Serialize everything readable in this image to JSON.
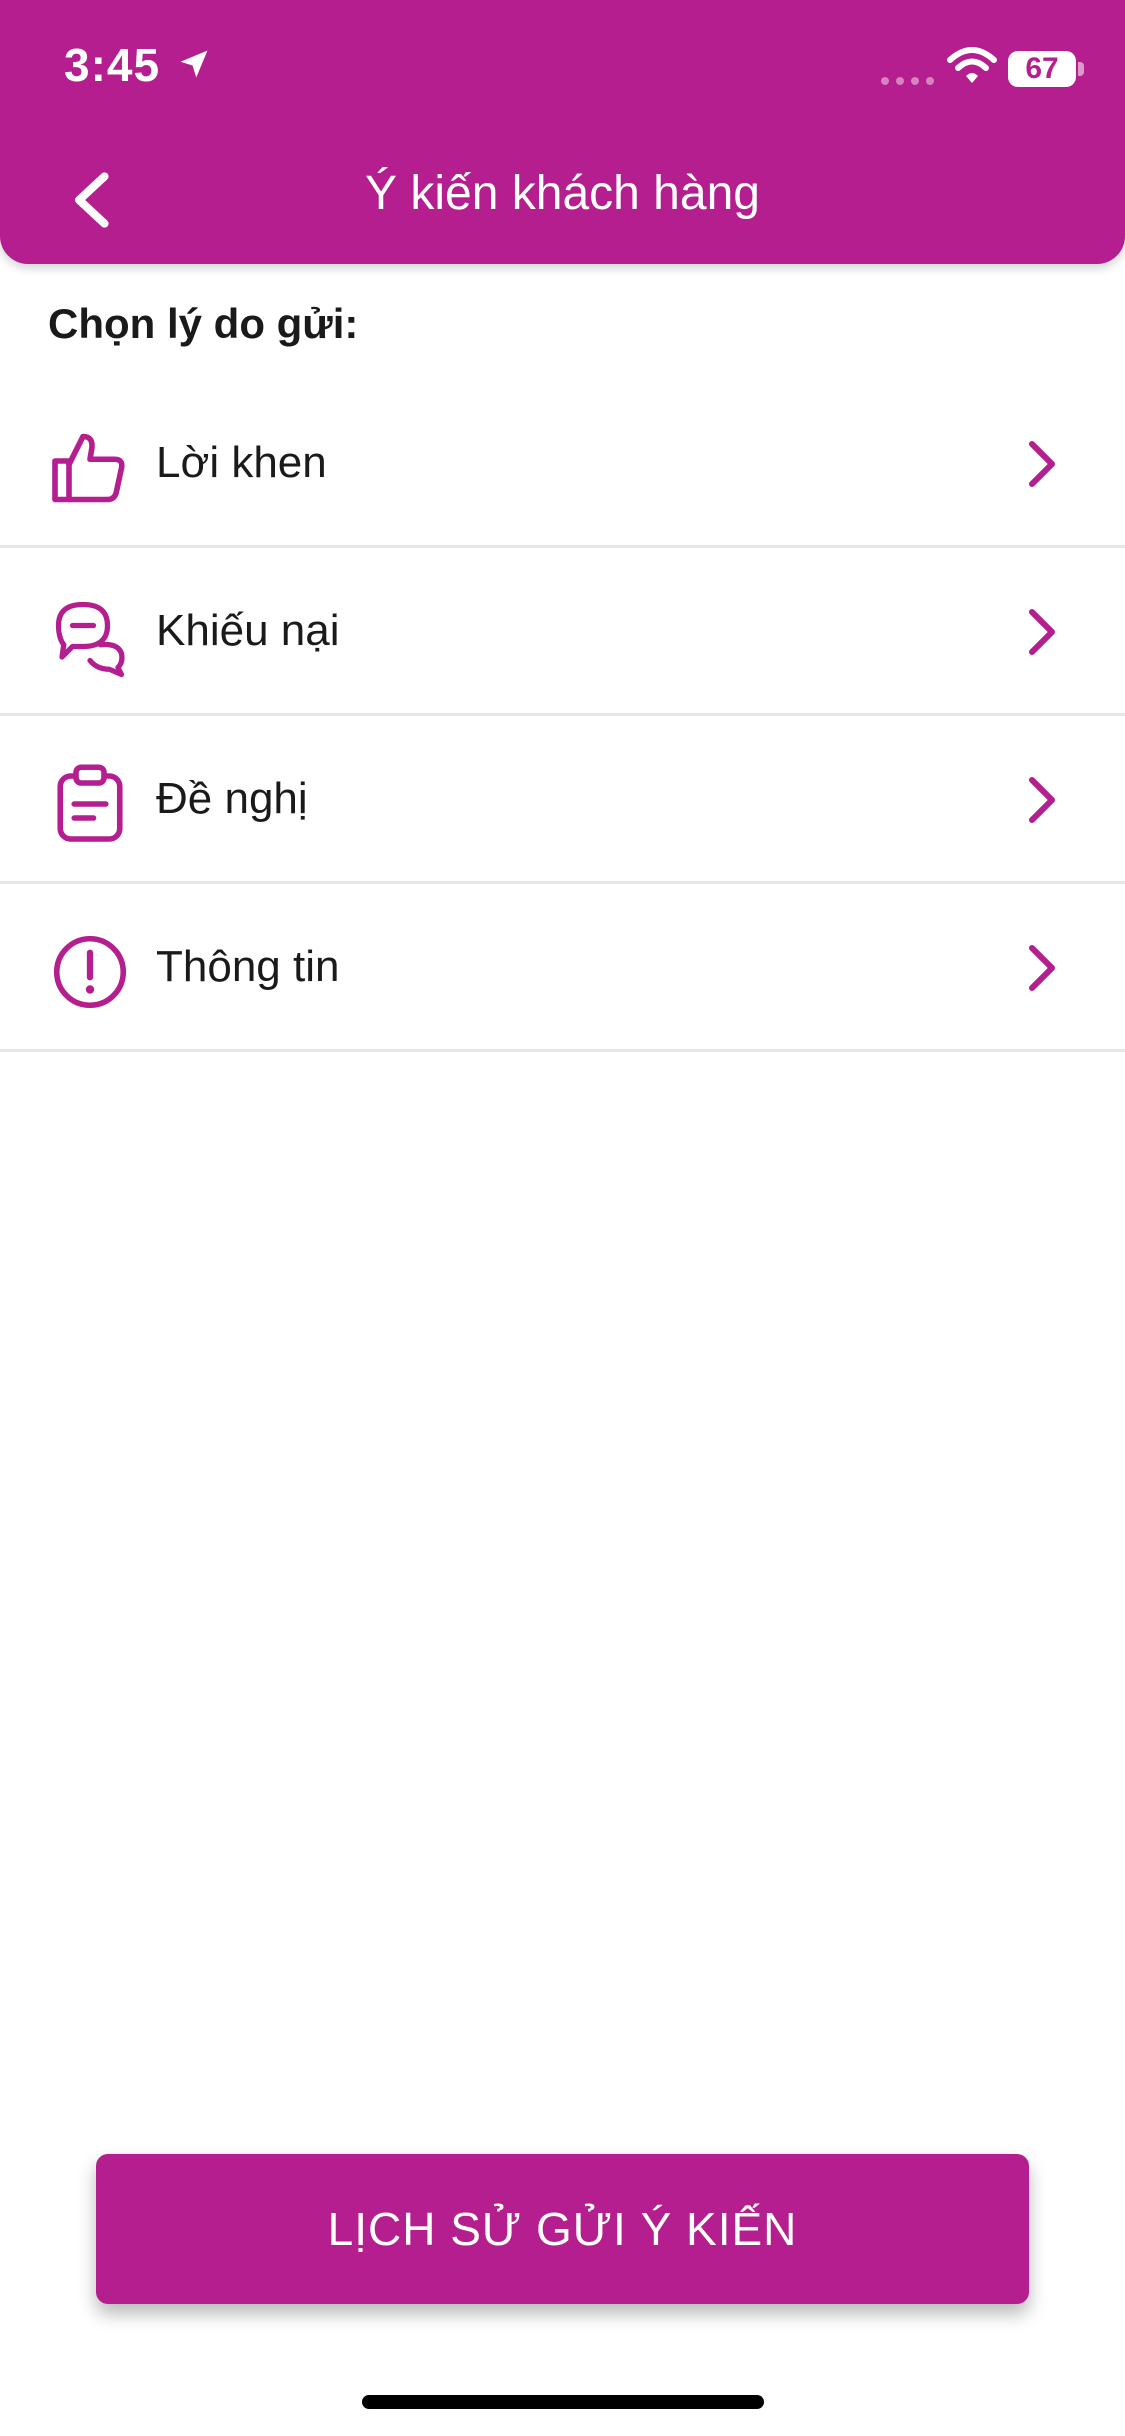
{
  "status_bar": {
    "time": "3:45",
    "battery": "67"
  },
  "nav": {
    "title": "Ý kiến khách hàng"
  },
  "section_label": "Chọn lý do gửi:",
  "reasons": [
    {
      "label": "Lời khen",
      "icon": "thumbs-up-icon"
    },
    {
      "label": "Khiếu nại",
      "icon": "chat-bubbles-icon"
    },
    {
      "label": "Đề nghị",
      "icon": "clipboard-icon"
    },
    {
      "label": "Thông tin",
      "icon": "exclamation-circle-icon"
    }
  ],
  "history_button": "LỊCH SỬ GỬI Ý KIẾN",
  "colors": {
    "primary": "#B41E8E",
    "divider": "#E6E6E6",
    "text": "#1a1a1a"
  }
}
